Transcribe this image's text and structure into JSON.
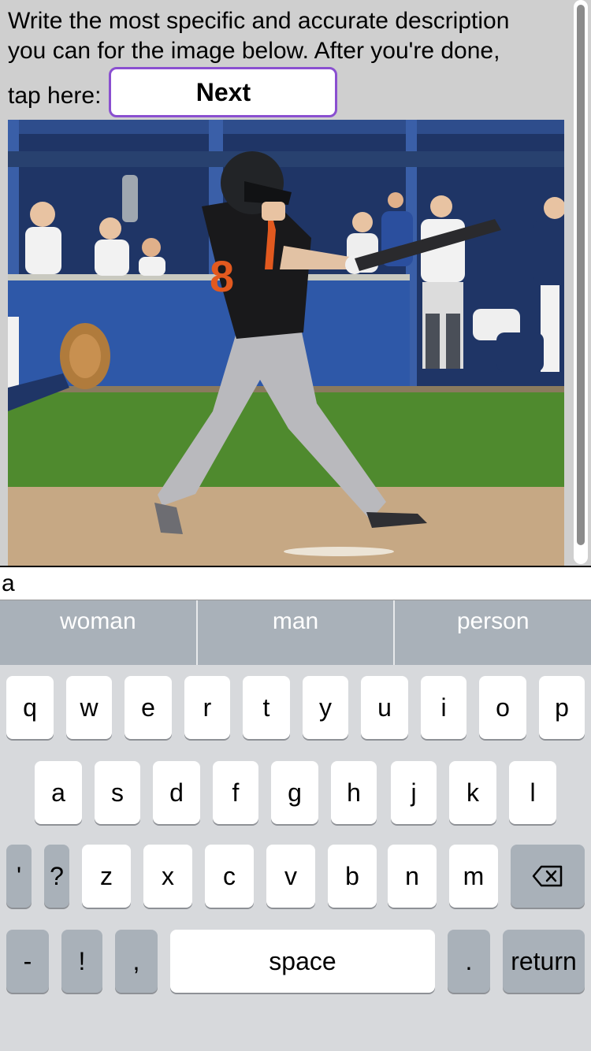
{
  "instructions": {
    "line1": "Write the most specific and accurate description",
    "line2": "you can for the image below. After you're done,",
    "tap_label": "tap here:",
    "next_label": "Next"
  },
  "photo": {
    "jersey_number": "8"
  },
  "input": {
    "value": "a"
  },
  "suggestions": [
    "woman",
    "man",
    "person"
  ],
  "keyboard": {
    "row1": [
      "q",
      "w",
      "e",
      "r",
      "t",
      "y",
      "u",
      "i",
      "o",
      "p"
    ],
    "row2": [
      "a",
      "s",
      "d",
      "f",
      "g",
      "h",
      "j",
      "k",
      "l"
    ],
    "row3": [
      "'",
      "?",
      "z",
      "x",
      "c",
      "v",
      "b",
      "n",
      "m"
    ],
    "backspace_icon": "backspace-icon",
    "row4": {
      "dash": "-",
      "bang": "!",
      "comma": ",",
      "space": "space",
      "period": ".",
      "return": "return"
    }
  }
}
